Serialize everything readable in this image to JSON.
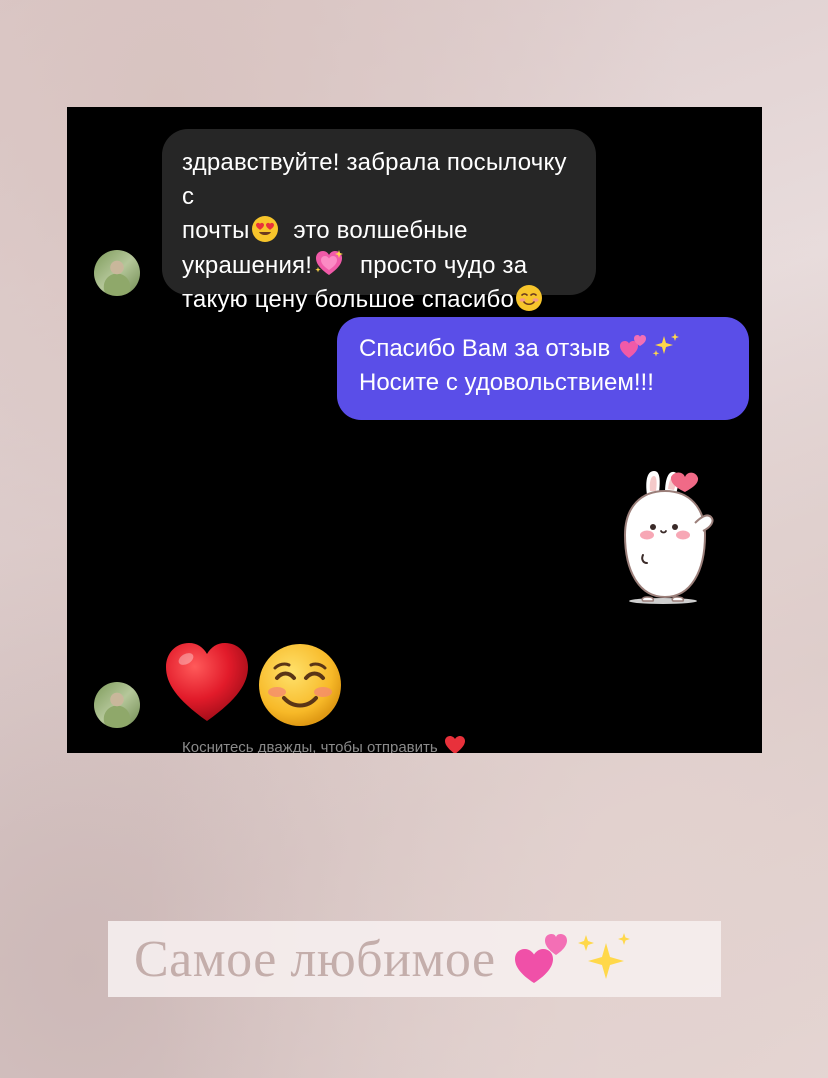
{
  "chat": {
    "incoming_message": {
      "line1": "здравствуйте! забрала посылочку с",
      "line2_text": "почты",
      "line2_emoji": "heart-eyes-emoji",
      "line2_rest": " это волшебные",
      "line3_text": "украшения!",
      "line3_emoji": "sparkling-heart-emoji",
      "line3_rest": " просто чудо за",
      "line4_text": "такую цену большое спасибо",
      "line4_emoji": "smiling-blush-emoji"
    },
    "outgoing_message": {
      "line1": "Спасибо Вам за отзыв",
      "line1_emoji": "two-hearts-sparkles-emoji",
      "line2": "Носите с удовольствием!!!"
    },
    "sticker": "bunny-heart-sticker",
    "emoji_reply": [
      "red-heart-emoji",
      "smiling-blush-emoji"
    ],
    "hint": "Коснитесь дважды, чтобы отправить"
  },
  "caption": {
    "text": "Самое любимое"
  },
  "colors": {
    "incoming_bubble": "#262626",
    "outgoing_bubble": "#5a4ee8",
    "background": "#000000",
    "caption_text": "#c4aeab"
  }
}
